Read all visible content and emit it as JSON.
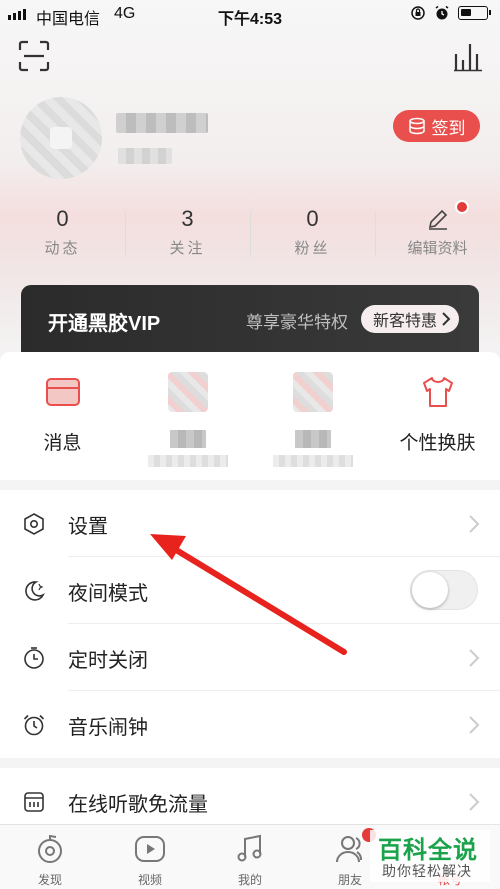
{
  "status_bar": {
    "carrier": "中国电信",
    "network": "4G",
    "time": "下午4:53"
  },
  "header": {
    "scan_icon": "scan-icon",
    "bars_icon": "audio-bars-icon"
  },
  "profile": {
    "checkin_label": "签到"
  },
  "stats": [
    {
      "num": "0",
      "label": "动态"
    },
    {
      "num": "3",
      "label": "关注"
    },
    {
      "num": "0",
      "label": "粉丝"
    },
    {
      "label": "编辑资料"
    }
  ],
  "vip": {
    "title": "开通黑胶VIP",
    "subtitle": "尊享豪华特权",
    "button": "新客特惠"
  },
  "quick": [
    {
      "label": "消息",
      "icon": "message-icon"
    },
    {
      "label": "",
      "icon": "blurred-icon"
    },
    {
      "label": "",
      "icon": "blurred-icon"
    },
    {
      "label": "个性换肤",
      "icon": "shirt-icon"
    }
  ],
  "menu": {
    "settings": "设置",
    "night_mode": "夜间模式",
    "timer_close": "定时关闭",
    "alarm": "音乐闹钟",
    "free_data": "在线听歌免流量"
  },
  "tabs": [
    {
      "label": "发现"
    },
    {
      "label": "视频"
    },
    {
      "label": "我的"
    },
    {
      "label": "朋友"
    },
    {
      "label": "帐号"
    }
  ],
  "watermark": {
    "title": "百科全说",
    "subtitle": "助你轻松解决"
  },
  "colors": {
    "accent_red": "#e9504d",
    "annotation_arrow": "#e8221c",
    "watermark_green": "#1aa34a"
  }
}
